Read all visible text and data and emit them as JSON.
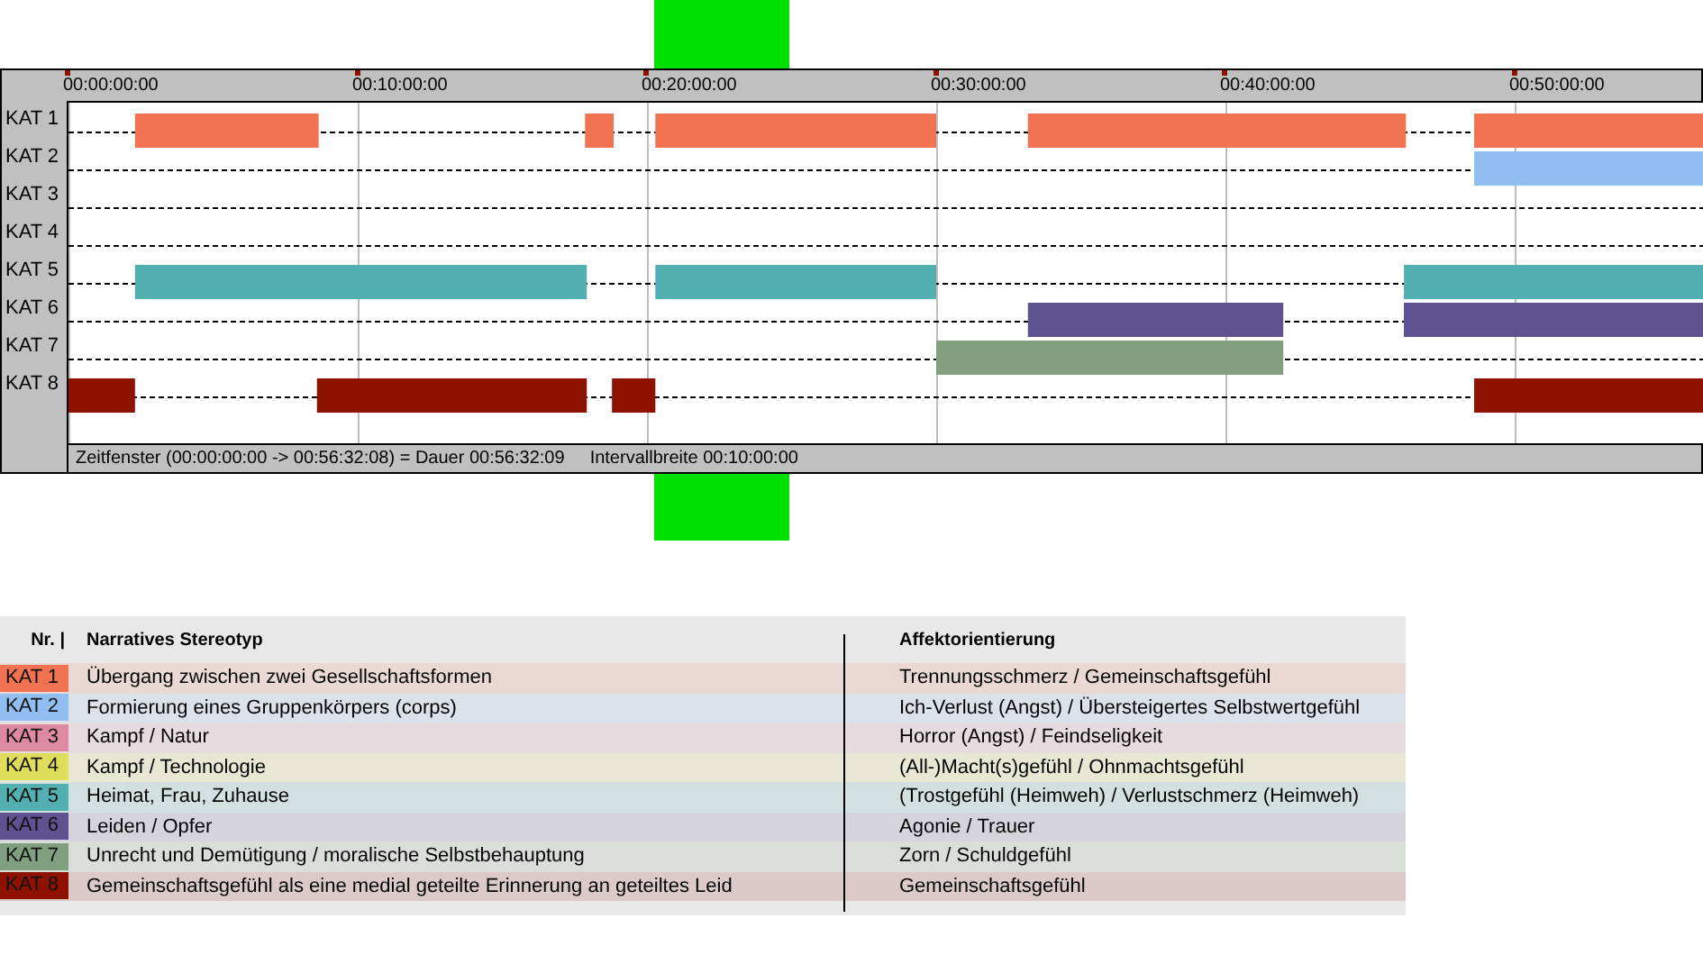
{
  "timeline": {
    "ticks": [
      "00:00:00:00",
      "00:10:00:00",
      "00:20:00:00",
      "00:30:00:00",
      "00:40:00:00",
      "00:50:00:00"
    ],
    "lanes": [
      {
        "label": "KAT 1",
        "color": "#f27352"
      },
      {
        "label": "KAT 2",
        "color": "#90bef0"
      },
      {
        "label": "KAT 3"
      },
      {
        "label": "KAT 4"
      },
      {
        "label": "KAT 5",
        "color": "#52b0b0"
      },
      {
        "label": "KAT 6",
        "color": "#5e5290"
      },
      {
        "label": "KAT 7",
        "color": "#80a080"
      },
      {
        "label": "KAT 8",
        "color": "#8e1200"
      }
    ],
    "status": "Zeitfenster (00:00:00:00 -> 00:56:32:08) = Dauer 00:56:32:09",
    "interval": "Intervallbreite 00:10:00:00"
  },
  "legend": {
    "columns": [
      "Nr. |",
      "Narratives Stereotyp",
      "Affektorientierung"
    ],
    "rows": [
      {
        "nr": "KAT 1",
        "color": "#f27352",
        "stereotype": "Übergang zwischen zwei Gesellschaftsformen",
        "affect": "Trennungsschmerz / Gemeinschaftsgefühl"
      },
      {
        "nr": "KAT 2",
        "color": "#90bef0",
        "stereotype": "Formierung eines Gruppenkörpers (corps)",
        "affect": "Ich-Verlust (Angst) / Übersteigertes Selbstwertgefühl"
      },
      {
        "nr": "KAT 3",
        "color": "#dd8aa0",
        "stereotype": "Kampf / Natur",
        "affect": "Horror (Angst) / Feindseligkeit"
      },
      {
        "nr": "KAT 4",
        "color": "#dede5a",
        "stereotype": "Kampf / Technologie",
        "affect": "(All-)Macht(s)gefühl / Ohnmachtsgefühl"
      },
      {
        "nr": "KAT 5",
        "color": "#52b0b0",
        "stereotype": "Heimat, Frau, Zuhause",
        "affect": "(Trostgefühl (Heimweh) / Verlustschmerz (Heimweh)"
      },
      {
        "nr": "KAT 6",
        "color": "#5e5290",
        "stereotype": "Leiden / Opfer",
        "affect": "Agonie / Trauer"
      },
      {
        "nr": "KAT 7",
        "color": "#80a080",
        "stereotype": "Unrecht und Demütigung / moralische Selbstbehauptung",
        "affect": "Zorn / Schuldgefühl"
      },
      {
        "nr": "KAT 8",
        "color": "#8e1200",
        "stereotype": "Gemeinschaftsgefühl als eine medial geteilte Erinnerung an geteiltes Leid",
        "affect": "Gemeinschaftsgefühl"
      }
    ]
  }
}
